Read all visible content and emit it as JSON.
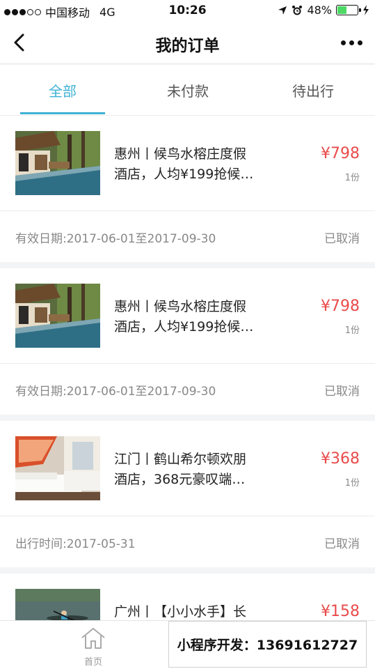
{
  "status_bar": {
    "carrier": "中国移动",
    "network": "4G",
    "time": "10:26",
    "battery": "48%",
    "battery_level": 0.48
  },
  "header": {
    "title": "我的订单"
  },
  "tabs": [
    {
      "label": "全部",
      "active": true
    },
    {
      "label": "未付款",
      "active": false
    },
    {
      "label": "待出行",
      "active": false
    }
  ],
  "orders": [
    {
      "title": "惠州丨候鸟水榕庄度假\n酒店，人均¥199抢候…",
      "price": "¥798",
      "qty": "1份",
      "date": "有效日期:2017-06-01至2017-09-30",
      "status": "已取消",
      "thumb": "resort-pool-photo"
    },
    {
      "title": "惠州丨候鸟水榕庄度假\n酒店，人均¥199抢候…",
      "price": "¥798",
      "qty": "1份",
      "date": "有效日期:2017-06-01至2017-09-30",
      "status": "已取消",
      "thumb": "resort-pool-photo"
    },
    {
      "title": "江门丨鹤山希尔顿欢朋\n酒店，368元豪叹端…",
      "price": "¥368",
      "qty": "1份",
      "date": "出行时间:2017-05-31",
      "status": "已取消",
      "thumb": "hotel-room-photo"
    },
    {
      "title": "广州丨【小小水手】长",
      "price": "¥158",
      "qty": "",
      "date": "",
      "status": "",
      "thumb": "kayak-water-photo"
    }
  ],
  "tabbar": {
    "home_label": "首页"
  },
  "promo": {
    "text": "小程序开发：13691612727"
  },
  "colors": {
    "accent": "#3fb1d5",
    "price": "#e94b4b",
    "muted": "#888888"
  }
}
